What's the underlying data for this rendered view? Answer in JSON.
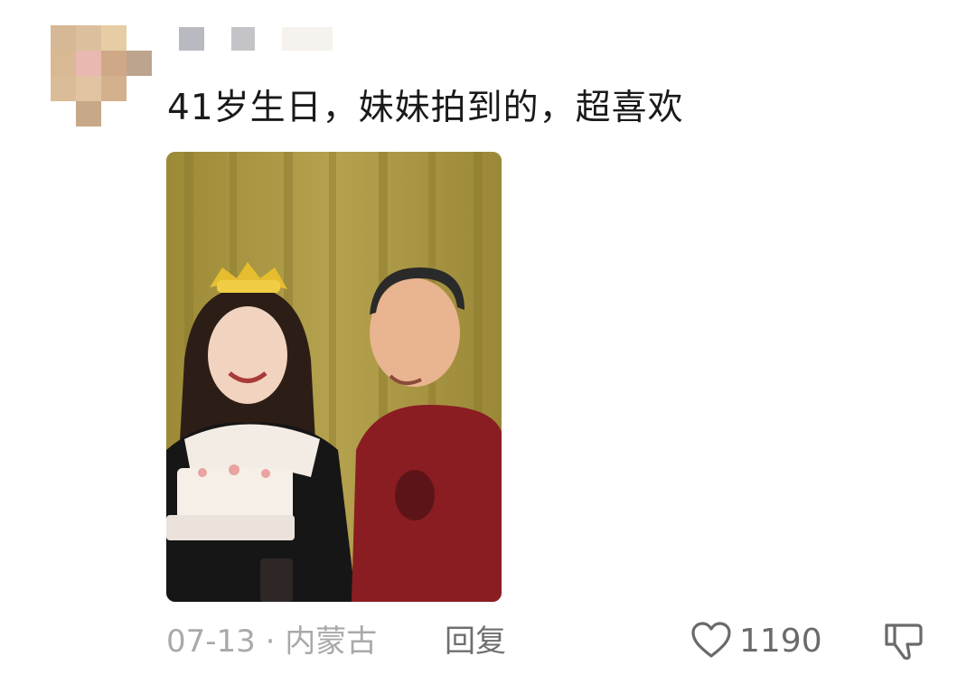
{
  "comment": {
    "text": "41岁生日，妹妹拍到的，超喜欢",
    "date": "07-13",
    "separator": "·",
    "location": "内蒙古",
    "reply_label": "回复",
    "like_count": "1190"
  },
  "icons": {
    "like": "heart-icon",
    "dislike": "thumbs-down-icon"
  },
  "colors": {
    "text": "#1a1a1a",
    "meta": "#a9a9a9",
    "action": "#6a6a6a",
    "background": "#ffffff"
  }
}
